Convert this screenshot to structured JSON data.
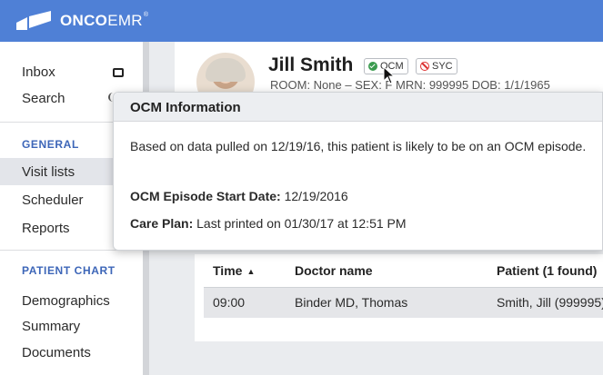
{
  "app": {
    "logo_text_bold": "ONCO",
    "logo_text_regular": "EMR",
    "logo_trademark": "®",
    "brand_color": "#4f80d6"
  },
  "sidebar": {
    "items_top": [
      {
        "label": "Inbox",
        "icon": "inbox-icon"
      },
      {
        "label": "Search",
        "icon": "search-icon"
      }
    ],
    "sections": [
      {
        "title": "GENERAL",
        "items": [
          "Visit lists",
          "Scheduler",
          "Reports"
        ],
        "active": "Visit lists"
      },
      {
        "title": "PATIENT CHART",
        "items": [
          "Demographics",
          "Summary",
          "Documents"
        ]
      }
    ],
    "section_color": "#3d66b8"
  },
  "patient": {
    "name": "Jill Smith",
    "badges": [
      {
        "label": "OCM",
        "icon": "check-circle-icon",
        "color": "#3a9b4e"
      },
      {
        "label": "SYC",
        "icon": "prohibited-icon",
        "color": "#dd3333"
      }
    ],
    "meta_line": "ROOM: None – SEX: F   MRN: 999995   DOB: 1/1/1965"
  },
  "popup": {
    "title": "OCM Information",
    "body": "Based on data pulled on 12/19/16, this patient is likely to be on an OCM episode.",
    "start_date_label": "OCM Episode Start Date:",
    "start_date_value": "12/19/2016",
    "care_plan_label": "Care Plan:",
    "care_plan_value": "Last printed on 01/30/17 at 12:51 PM"
  },
  "table": {
    "columns": [
      {
        "label": "Time",
        "sort": "ascending",
        "sort_glyph": "▲"
      },
      {
        "label": "Doctor name"
      },
      {
        "label": "Patient (1 found)"
      }
    ],
    "rows": [
      [
        "09:00",
        "Binder MD, Thomas",
        "Smith, Jill (999995)"
      ]
    ]
  }
}
